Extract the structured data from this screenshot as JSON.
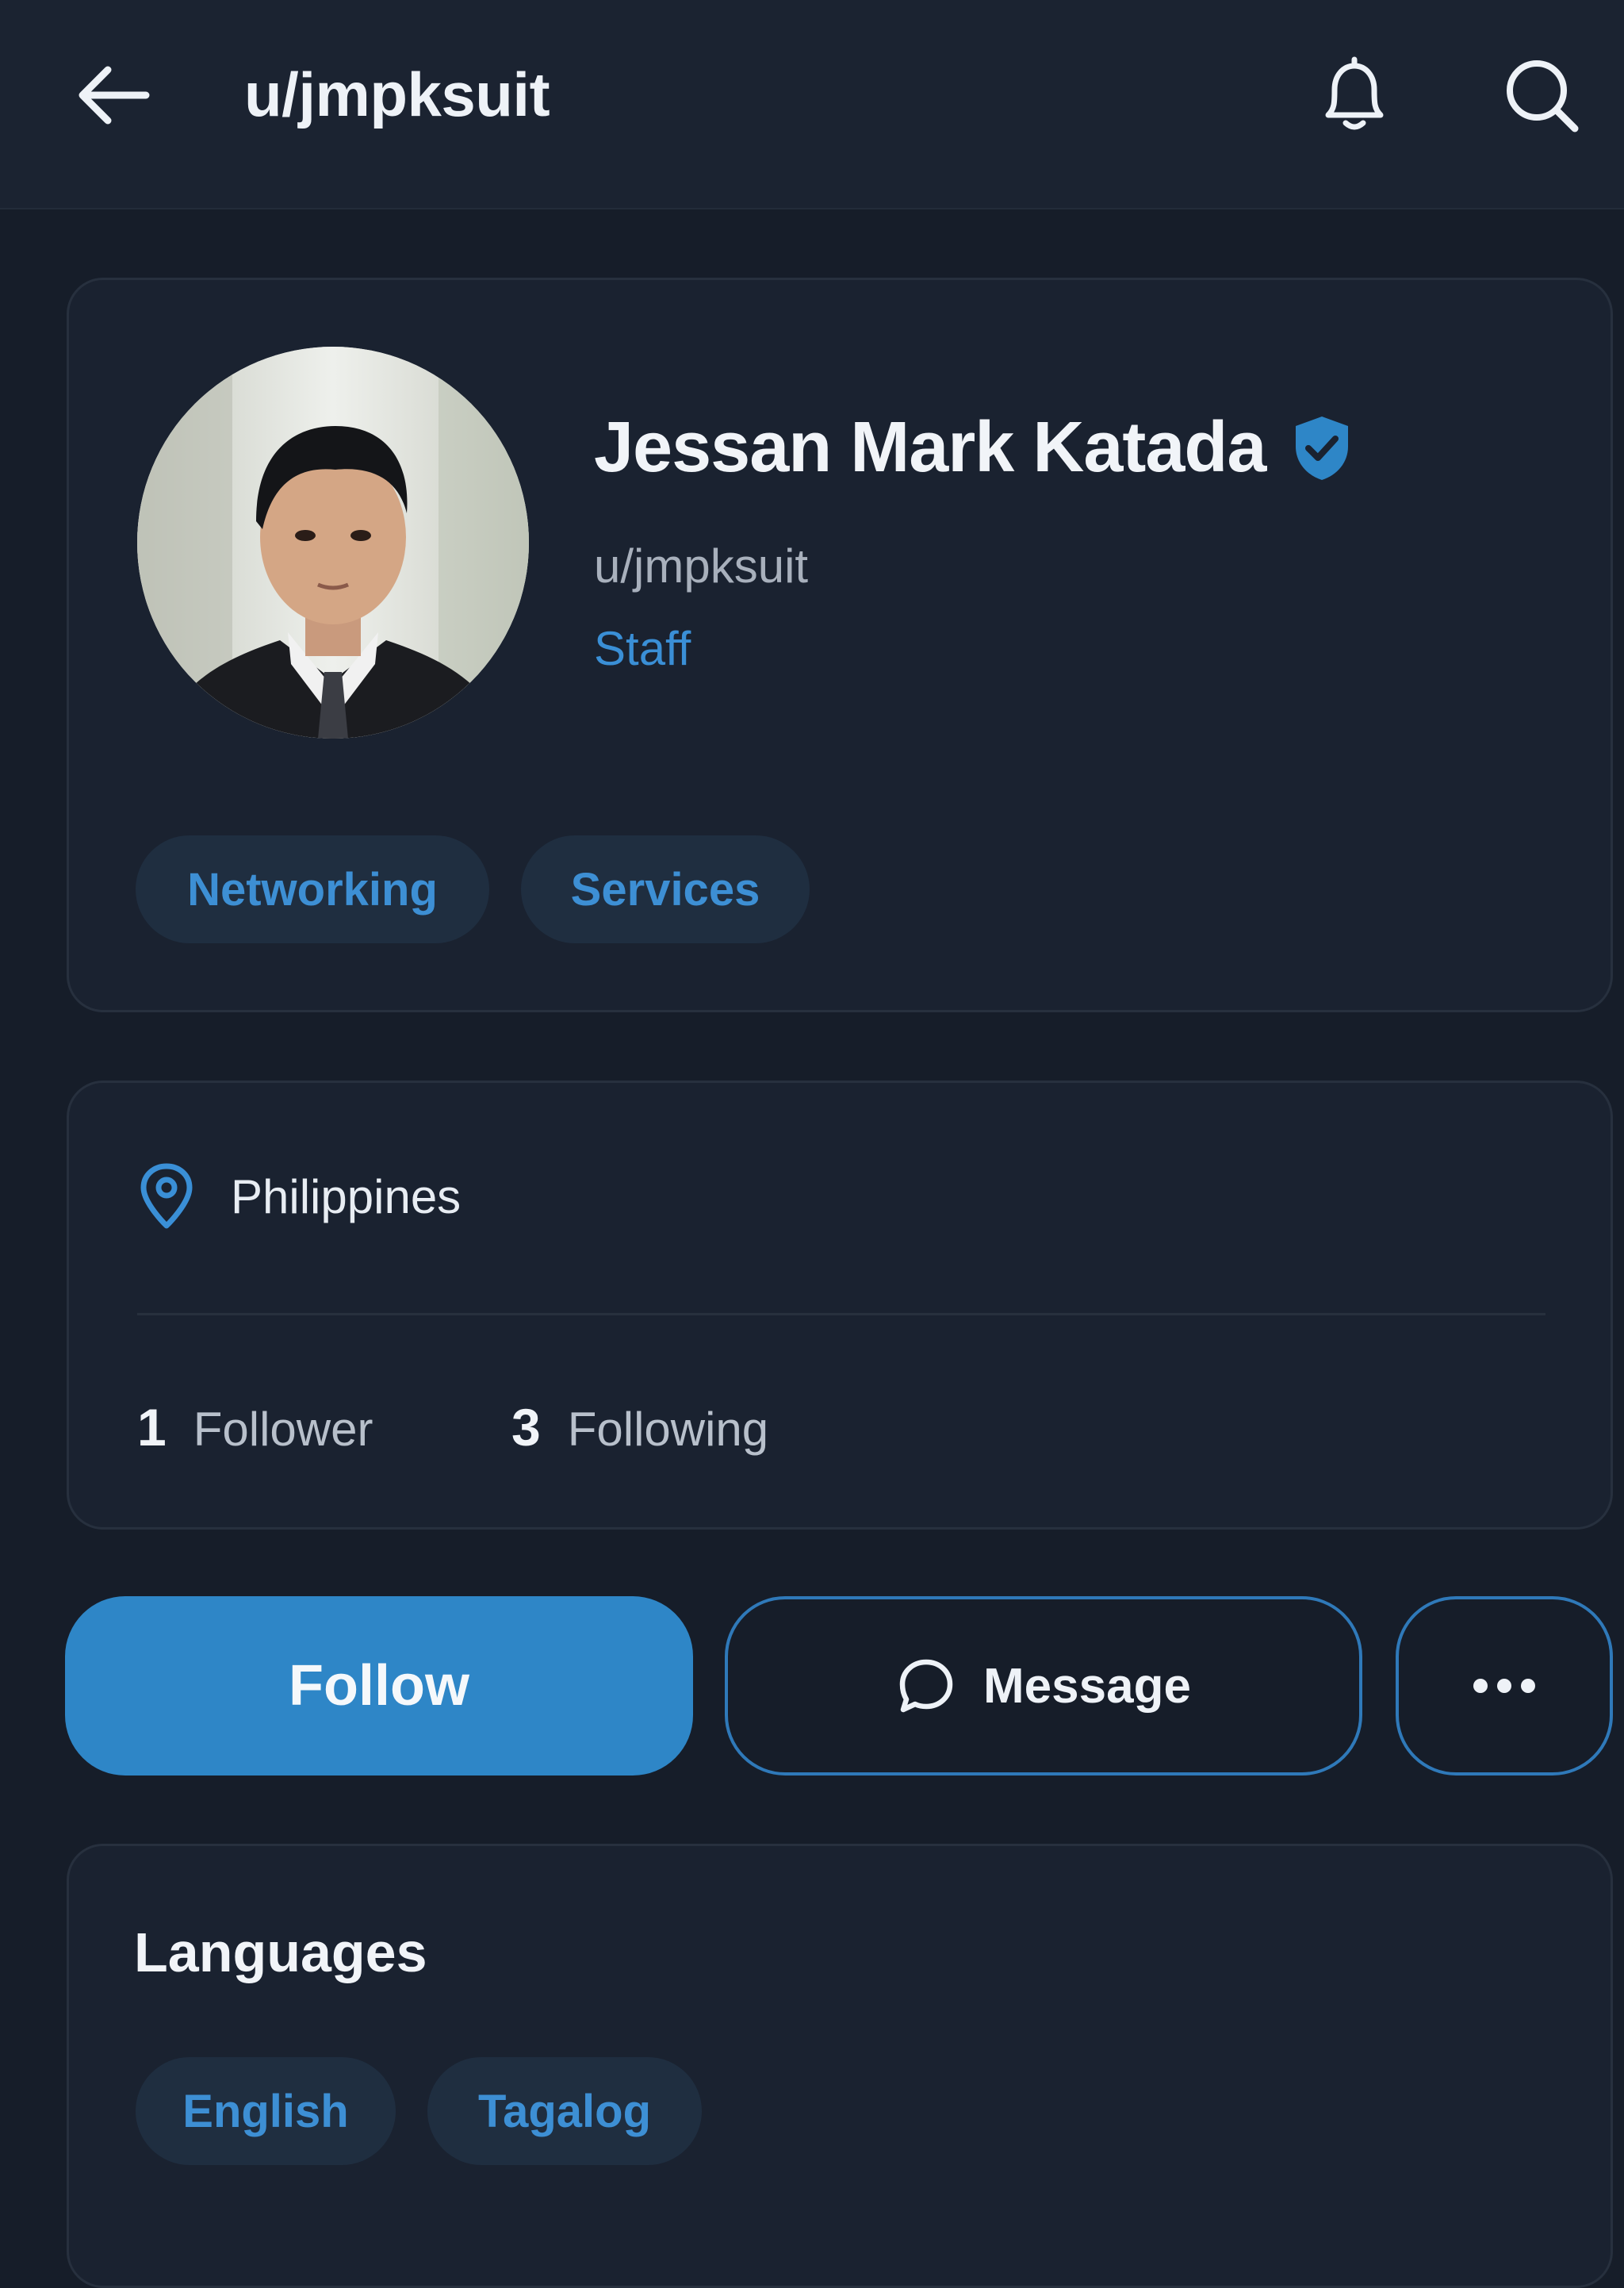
{
  "header": {
    "title": "u/jmpksuit",
    "back_icon": "arrow-left-icon",
    "bell_icon": "bell-icon",
    "search_icon": "search-icon"
  },
  "profile": {
    "display_name": "Jessan Mark Katada",
    "verified_icon": "verified-shield-icon",
    "username": "u/jmpksuit",
    "role": "Staff",
    "tags": [
      "Networking",
      "Services"
    ]
  },
  "info": {
    "location_icon": "location-pin-icon",
    "location": "Philippines",
    "followers": {
      "count": "1",
      "label": "Follower"
    },
    "following": {
      "count": "3",
      "label": "Following"
    }
  },
  "actions": {
    "follow_label": "Follow",
    "message_label": "Message",
    "message_icon": "chat-bubble-icon",
    "more_icon": "more-horizontal-icon"
  },
  "languages": {
    "title": "Languages",
    "items": [
      "English",
      "Tagalog"
    ]
  },
  "colors": {
    "background": "#161d29",
    "header": "#1b2331",
    "card": "#1a2230",
    "accent": "#2e86c7",
    "chip_bg": "#1f2e40",
    "chip_text": "#3d8fd4"
  }
}
